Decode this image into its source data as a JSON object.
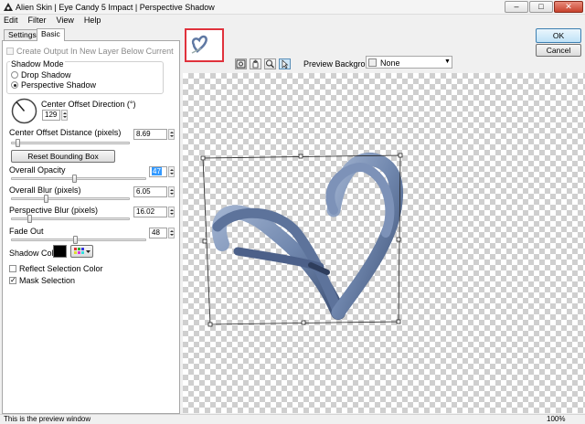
{
  "window": {
    "title": "Alien Skin | Eye Candy 5 Impact | Perspective Shadow"
  },
  "window_controls": {
    "minimize": "–",
    "maximize": "□",
    "close": "✕"
  },
  "menu": [
    "Edit",
    "Filter",
    "View",
    "Help"
  ],
  "tabs": {
    "settings": "Settings",
    "basic": "Basic"
  },
  "basic": {
    "create_output_label": "Create Output In New Layer Below Current",
    "create_output_checked": false,
    "shadow_mode_label": "Shadow Mode",
    "shadow_mode_options": [
      "Drop Shadow",
      "Perspective Shadow"
    ],
    "shadow_mode_selected": "Perspective Shadow",
    "center_offset_direction_label": "Center Offset Direction (°)",
    "center_offset_direction_value": "129",
    "center_offset_distance_label": "Center Offset Distance (pixels)",
    "center_offset_distance_value": "8.69",
    "center_offset_distance_slider": 0.06,
    "reset_bounding_box_label": "Reset Bounding Box",
    "overall_opacity_label": "Overall Opacity",
    "overall_opacity_value": "47",
    "overall_opacity_slider": 0.47,
    "overall_blur_label": "Overall Blur (pixels)",
    "overall_blur_value": "6.05",
    "overall_blur_slider": 0.3,
    "perspective_blur_label": "Perspective Blur (pixels)",
    "perspective_blur_value": "16.02",
    "perspective_blur_slider": 0.16,
    "fade_out_label": "Fade Out",
    "fade_out_value": "48",
    "fade_out_slider": 0.48,
    "shadow_color_label": "Shadow Color",
    "shadow_color": "#000000",
    "reflect_selection_color_label": "Reflect Selection Color",
    "reflect_selection_color_checked": false,
    "mask_selection_label": "Mask Selection",
    "mask_selection_checked": true
  },
  "buttons": {
    "ok": "OK",
    "cancel": "Cancel"
  },
  "preview": {
    "background_label": "Preview Background:",
    "background_value": "None",
    "tools": [
      "zoom-fit-icon",
      "hand-icon",
      "zoom-icon",
      "arrow-icon"
    ],
    "active_tool": "arrow-icon"
  },
  "status": {
    "text": "This is the preview window",
    "zoom": "100%"
  },
  "colors": {
    "ribbon": "#6f86ad",
    "ribbon_dark": "#3f5276",
    "selection_box": "#e0323c",
    "accent": "#3399ff"
  }
}
